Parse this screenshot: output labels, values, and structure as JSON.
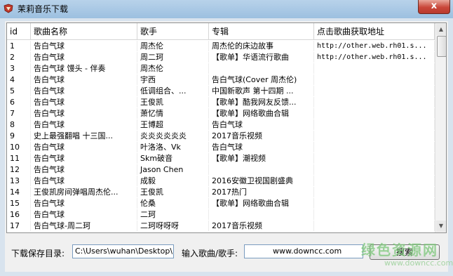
{
  "window": {
    "title": "茉莉音乐下载",
    "close_label": "x"
  },
  "table": {
    "columns": [
      "id",
      "歌曲名称",
      "歌手",
      "专辑",
      "点击歌曲获取地址"
    ],
    "rows": [
      [
        "1",
        "告白气球",
        "周杰伦",
        "周杰伦的床边故事",
        "http://other.web.rh01.s..."
      ],
      [
        "2",
        "告白气球",
        "周二珂",
        "【歌单】华语流行歌曲",
        "http://other.web.rh01.s..."
      ],
      [
        "3",
        "告白气球 馒头 - 伴奏",
        "周杰伦",
        "",
        ""
      ],
      [
        "4",
        "告白气球",
        "宇西",
        "告白气球(Cover 周杰伦)",
        ""
      ],
      [
        "5",
        "告白气球",
        "低调组合、...",
        "中国新歌声 第十四期 ...",
        ""
      ],
      [
        "6",
        "告白气球",
        "王俊凯",
        "【歌单】酷我网友反馈...",
        ""
      ],
      [
        "7",
        "告白气球",
        "萧忆情",
        "【歌单】网络歌曲合辑",
        ""
      ],
      [
        "8",
        "告白气球",
        "王博超",
        "告白气球",
        ""
      ],
      [
        "9",
        "史上最强翻唱 十三国...",
        "炎炎炎炎炎炎",
        "2017音乐视频",
        ""
      ],
      [
        "10",
        "告白气球",
        "叶洛洛、Vk",
        "告白气球",
        ""
      ],
      [
        "11",
        "告白气球",
        "Skm破音",
        "【歌单】潮视频",
        ""
      ],
      [
        "12",
        "告白气球",
        "Jason Chen",
        "",
        ""
      ],
      [
        "13",
        "告白气球",
        "成毅",
        "2016安徽卫视国剧盛典",
        ""
      ],
      [
        "14",
        "王俊凯房间弹唱周杰伦...",
        "王俊凯",
        "2017热门",
        ""
      ],
      [
        "15",
        "告白气球",
        "伦桑",
        "【歌单】网络歌曲合辑",
        ""
      ],
      [
        "16",
        "告白气球",
        "二珂",
        "",
        ""
      ],
      [
        "17",
        "告白气球-周二珂",
        "二珂呀呀呀",
        "2017音乐视频",
        ""
      ]
    ]
  },
  "save_dir": {
    "label": "下载保存目录:",
    "value": "C:\\Users\\wuhan\\Desktop\\"
  },
  "search": {
    "label": "输入歌曲/歌手:",
    "value": "www.downcc.com",
    "button_label": "搜索"
  },
  "watermark": {
    "line1": "绿色资源网",
    "line2": "www.downcc.com"
  },
  "colors": {
    "titlebar": "#a9c9e6",
    "close": "#c9473a",
    "watermark": "#7cc77a"
  }
}
